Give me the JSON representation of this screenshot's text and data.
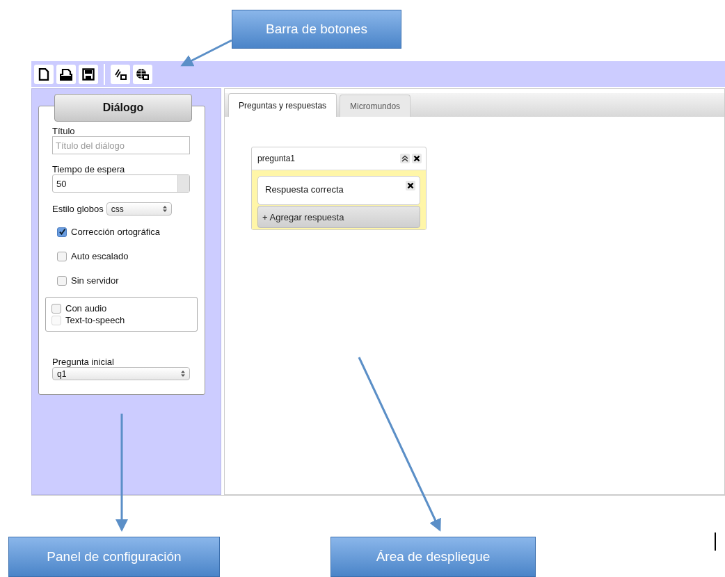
{
  "callouts": [
    {
      "text": "Barra de botones"
    },
    {
      "text": "Panel de configuración"
    },
    {
      "text": "Área de despliegue"
    }
  ],
  "toolbar": {
    "buttons": [
      {
        "kind": "new"
      },
      {
        "kind": "open"
      },
      {
        "kind": "save"
      },
      {
        "kind": "link"
      },
      {
        "kind": "globe"
      }
    ]
  },
  "panel": {
    "title": "Diálogo",
    "fields": [
      {
        "kind": "text",
        "label": "Título",
        "placeholder": "Título del diálogo"
      },
      {
        "kind": "spinner",
        "label": "Tiempo de espera",
        "value": "50"
      },
      {
        "kind": "inline-select",
        "label": "Estilo globos",
        "value": "css"
      },
      {
        "kind": "checkbox",
        "label": "Corrección ortográfica",
        "checked": true,
        "disabled": false
      },
      {
        "kind": "checkbox",
        "label": "Auto escalado",
        "checked": false,
        "disabled": false
      },
      {
        "kind": "checkbox",
        "label": "Sin servidor",
        "checked": false,
        "disabled": false
      },
      {
        "kind": "group",
        "items": [
          {
            "label": "Con audio",
            "checked": false,
            "disabled": false
          },
          {
            "label": "Text-to-speech",
            "checked": false,
            "disabled": true
          }
        ]
      },
      {
        "kind": "select",
        "label": "Pregunta inicial",
        "value": "q1"
      }
    ]
  },
  "tabs": [
    {
      "label": "Preguntas y respuestas",
      "selected": true
    },
    {
      "label": "Micromundos",
      "selected": false
    }
  ],
  "question": {
    "title": "pregunta1",
    "answers": [
      "Respuesta correcta"
    ],
    "add_label": "+ Agregar respuesta"
  }
}
